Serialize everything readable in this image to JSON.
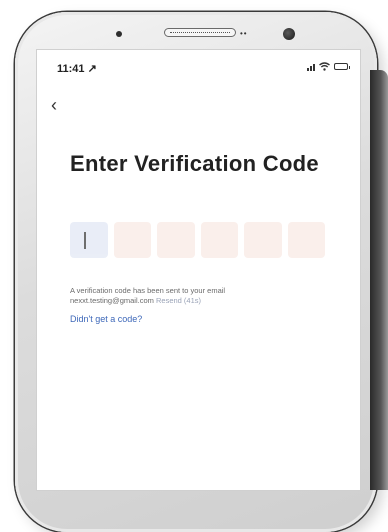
{
  "status_bar": {
    "time": "11:41 ↗"
  },
  "nav": {
    "back_symbol": "‹"
  },
  "page": {
    "title": "Enter Verification Code"
  },
  "code_input": {
    "digits": [
      "",
      "",
      "",
      "",
      "",
      ""
    ],
    "cursor": "|"
  },
  "info": {
    "message": "A verification code has been sent to your email",
    "email": "nexxt.testing@gmail.com",
    "resend_label": "Resend (41s)"
  },
  "help": {
    "link_label": "Didn't get a code?"
  },
  "colors": {
    "link": "#3e68b9",
    "code_box": "#f9ece7",
    "active_box": "#e6ebf6"
  }
}
